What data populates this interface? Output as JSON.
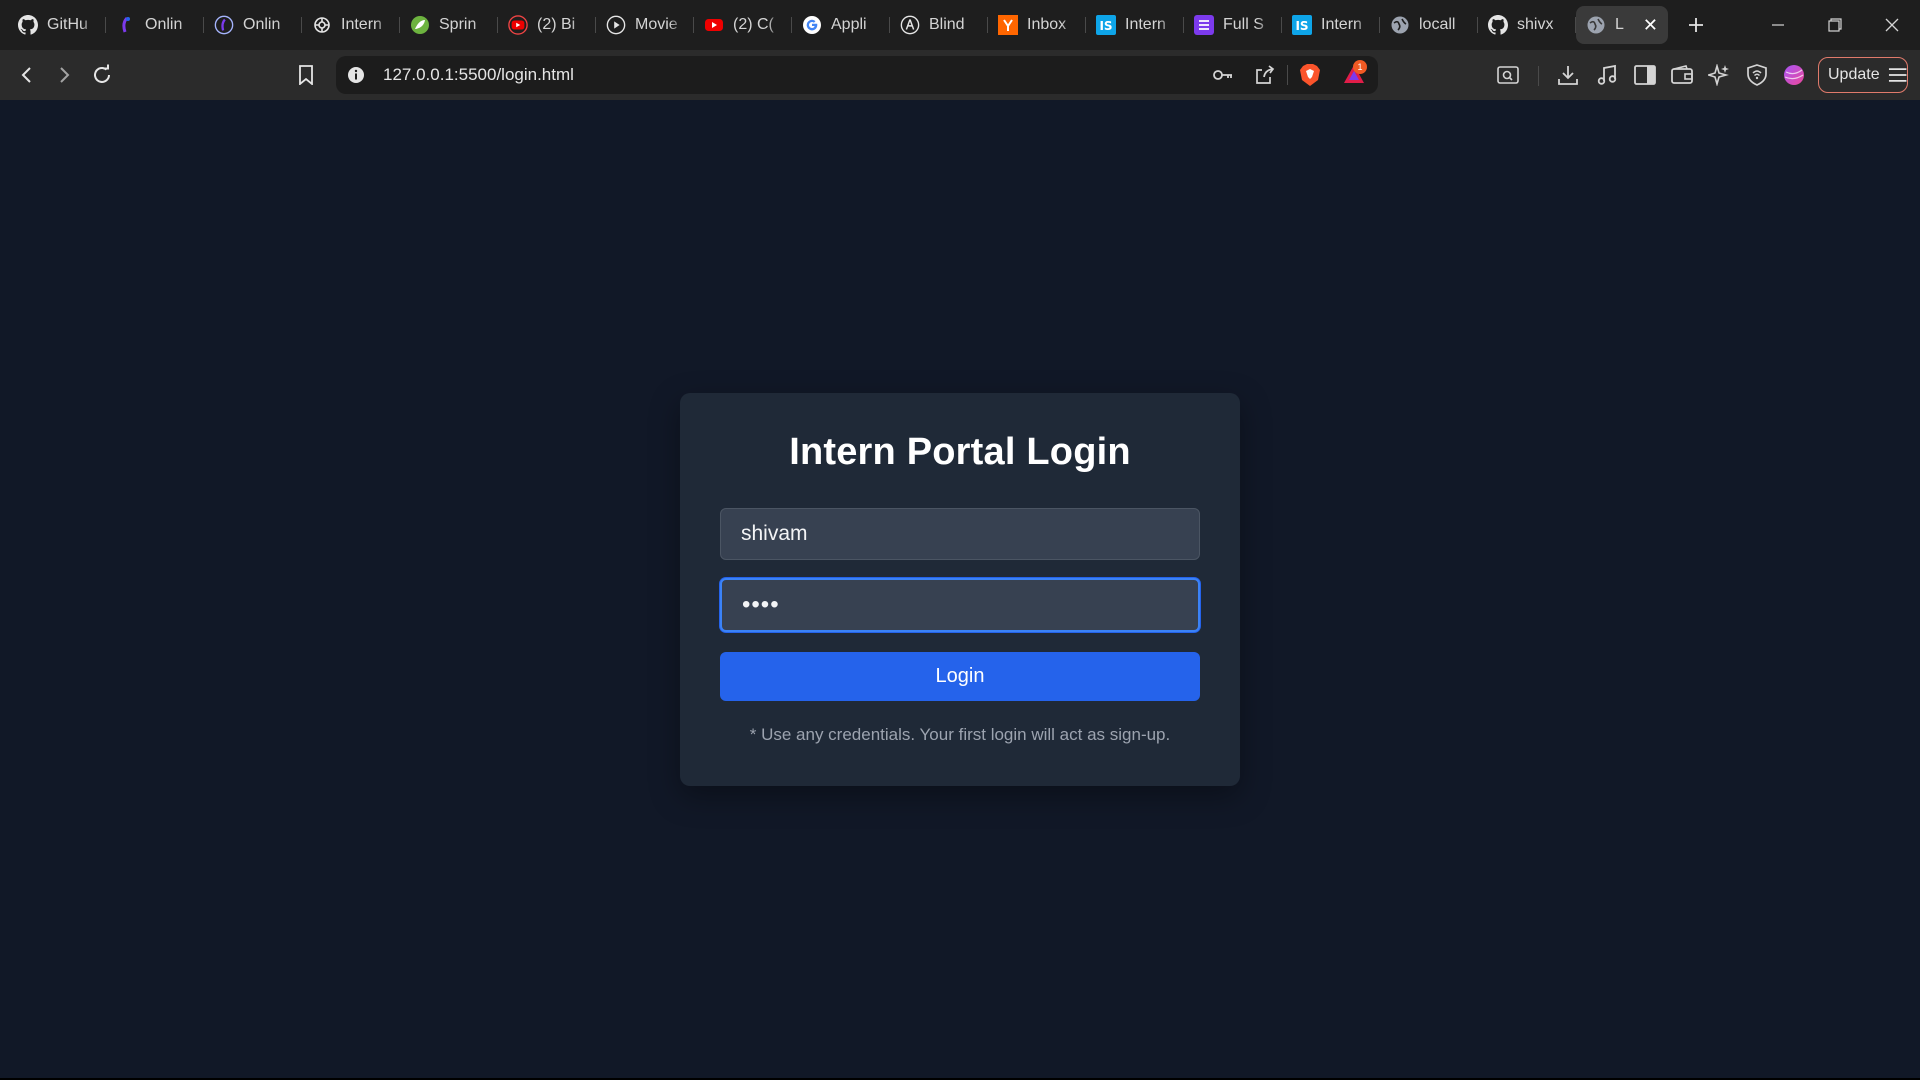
{
  "browser": {
    "tabs": [
      {
        "title": "GitHu",
        "icon": "github-icon"
      },
      {
        "title": "Onlin",
        "icon": "codechef-icon"
      },
      {
        "title": "Onlin",
        "icon": "codechef-circle-icon"
      },
      {
        "title": "Intern",
        "icon": "openai-icon"
      },
      {
        "title": "Sprin",
        "icon": "spring-icon"
      },
      {
        "title": "(2) Bi",
        "icon": "youtube-icon"
      },
      {
        "title": "Movie",
        "icon": "play-icon"
      },
      {
        "title": "(2) C(",
        "icon": "youtube-icon"
      },
      {
        "title": "Appli",
        "icon": "google-icon"
      },
      {
        "title": "Blind",
        "icon": "blind-icon"
      },
      {
        "title": "Inbox",
        "icon": "ycombinator-icon"
      },
      {
        "title": "Intern",
        "icon": "internshala-icon"
      },
      {
        "title": "Full S",
        "icon": "list-icon"
      },
      {
        "title": "Intern",
        "icon": "internshala-icon"
      },
      {
        "title": "locall",
        "icon": "globe-icon"
      },
      {
        "title": "shivx",
        "icon": "github-icon"
      },
      {
        "title": "L",
        "icon": "globe-icon",
        "active": true
      }
    ],
    "url": "127.0.0.1:5500/login.html",
    "update_label": "Update",
    "notification_count": "1"
  },
  "login": {
    "title": "Intern Portal Login",
    "username_value": "shivam",
    "password_value": "••••",
    "button_label": "Login",
    "note": "* Use any credentials. Your first login will act as sign-up."
  },
  "colors": {
    "page_bg": "#111827",
    "card_bg": "#1f2937",
    "input_bg": "#374151",
    "accent": "#2563eb",
    "focus_ring": "#3b82f6",
    "note_text": "#9ca3af"
  }
}
